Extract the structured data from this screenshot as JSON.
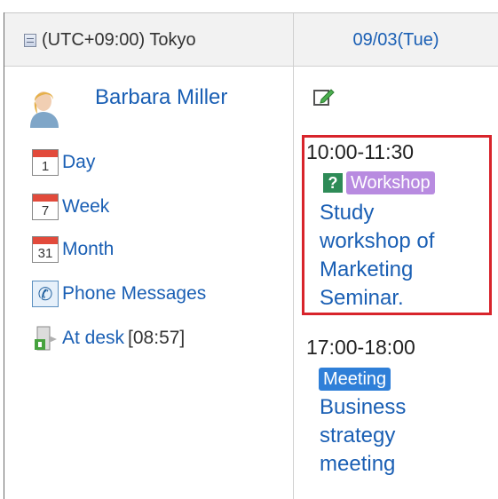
{
  "header": {
    "timezone": "(UTC+09:00) Tokyo",
    "date": "09/03(Tue)"
  },
  "user": {
    "name": "Barbara Miller"
  },
  "menu": {
    "items": [
      {
        "label": "Day",
        "icon": "calendar-day-icon",
        "icon_number": "1"
      },
      {
        "label": "Week",
        "icon": "calendar-week-icon",
        "icon_number": "7"
      },
      {
        "label": "Month",
        "icon": "calendar-month-icon",
        "icon_number": "31"
      },
      {
        "label": "Phone Messages",
        "icon": "phone-icon"
      }
    ],
    "status": {
      "label": "At desk",
      "time": "[08:57]",
      "icon": "at-desk-icon"
    }
  },
  "events": [
    {
      "time": "10:00-11:30",
      "tag": "Workshop",
      "tag_color": "#b88be0",
      "has_question_icon": true,
      "title_lines": [
        "Study",
        "workshop of",
        "Marketing",
        "Seminar."
      ],
      "highlighted": true
    },
    {
      "time": "17:00-18:00",
      "tag": "Meeting",
      "tag_color": "#2f7fd8",
      "has_question_icon": false,
      "title_lines": [
        "Business",
        "strategy",
        "meeting"
      ],
      "highlighted": false
    }
  ],
  "colors": {
    "link": "#1a5fb4",
    "highlight_border": "#d8242b",
    "header_bg": "#f2f2f2"
  }
}
